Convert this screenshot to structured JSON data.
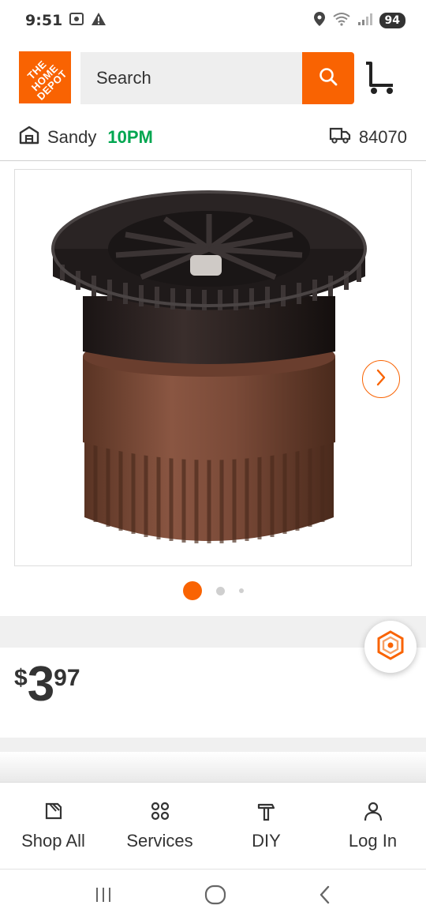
{
  "status_bar": {
    "time": "9:51",
    "battery": "94"
  },
  "header": {
    "logo_text": "THE\nHOME\nDEPOT",
    "search_placeholder": "Search"
  },
  "location": {
    "store": "Sandy",
    "hours": "10PM",
    "zip": "84070"
  },
  "gallery": {
    "image_count": 3,
    "active_index": 0
  },
  "price": {
    "currency": "$",
    "dollars": "3",
    "cents": "97"
  },
  "bottom_nav": [
    {
      "label": "Shop All",
      "icon": "shop-all-icon"
    },
    {
      "label": "Services",
      "icon": "services-icon"
    },
    {
      "label": "DIY",
      "icon": "hammer-icon"
    },
    {
      "label": "Log In",
      "icon": "user-icon"
    }
  ],
  "colors": {
    "accent": "#f96302",
    "hours_green": "#00a650",
    "text": "#333333"
  }
}
